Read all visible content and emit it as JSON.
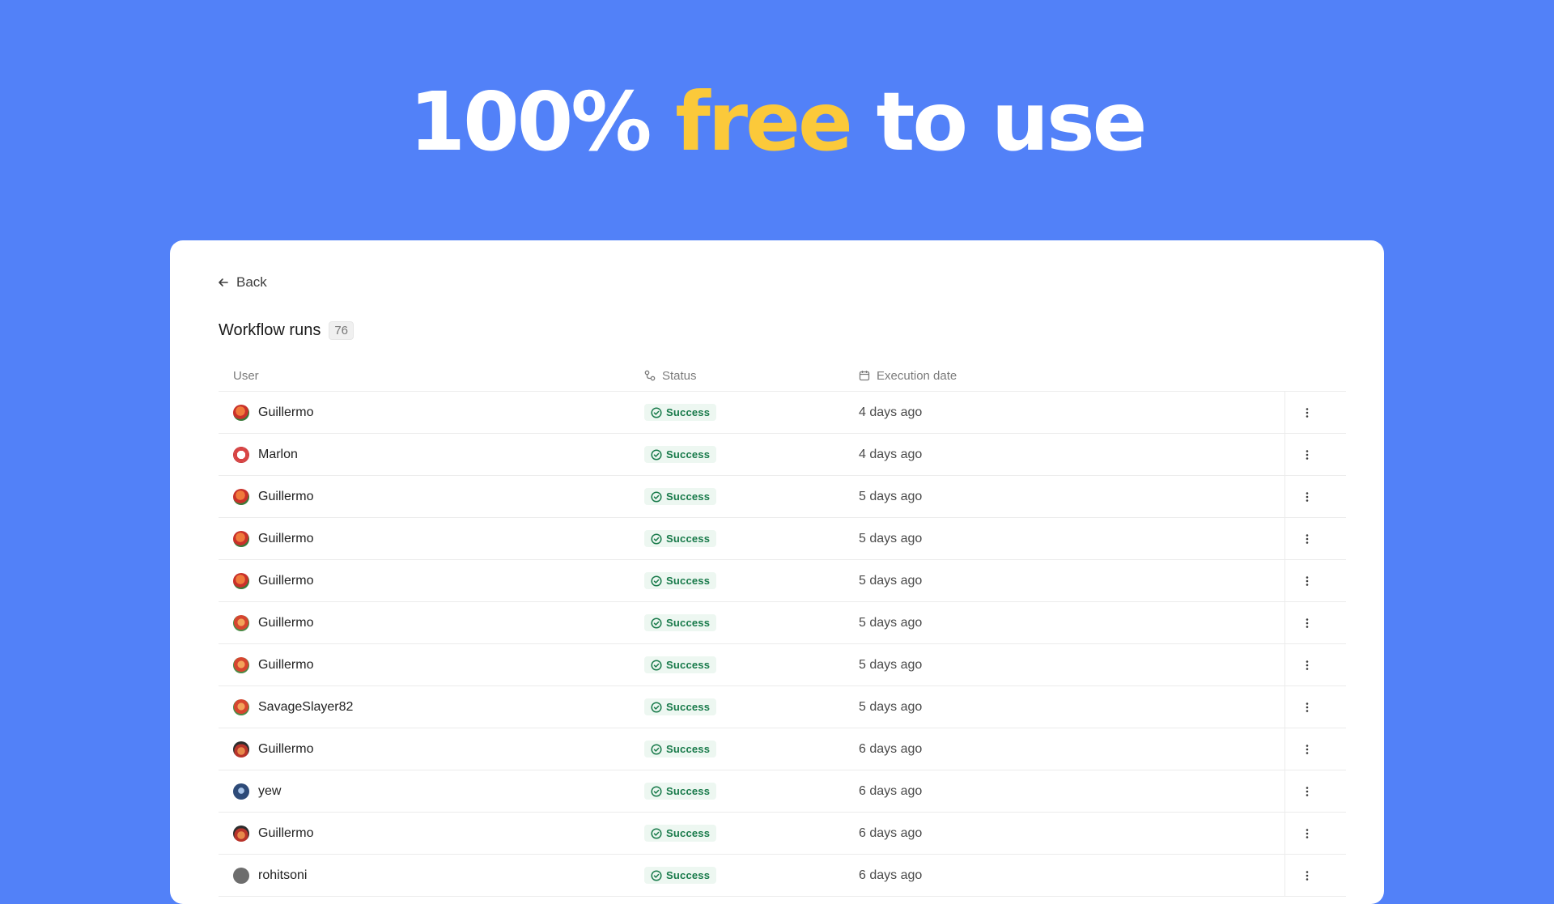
{
  "hero": {
    "part1": "100%",
    "accent": "free",
    "part2": "to use",
    "accent_color": "#fbc93a",
    "background_color": "#5281f8"
  },
  "panel": {
    "back_label": "Back",
    "title": "Workflow runs",
    "count": "76"
  },
  "table": {
    "columns": {
      "user": "User",
      "status": "Status",
      "execution_date": "Execution date"
    },
    "status_color": "#187a4a",
    "rows": [
      {
        "user": "Guillermo",
        "avatar": "red",
        "status": "Success",
        "date": "4 days ago"
      },
      {
        "user": "Marlon",
        "avatar": "clown",
        "status": "Success",
        "date": "4 days ago"
      },
      {
        "user": "Guillermo",
        "avatar": "red",
        "status": "Success",
        "date": "5 days ago"
      },
      {
        "user": "Guillermo",
        "avatar": "red",
        "status": "Success",
        "date": "5 days ago"
      },
      {
        "user": "Guillermo",
        "avatar": "red",
        "status": "Success",
        "date": "5 days ago"
      },
      {
        "user": "Guillermo",
        "avatar": "mix",
        "status": "Success",
        "date": "5 days ago"
      },
      {
        "user": "Guillermo",
        "avatar": "mix",
        "status": "Success",
        "date": "5 days ago"
      },
      {
        "user": "SavageSlayer82",
        "avatar": "mix",
        "status": "Success",
        "date": "5 days ago"
      },
      {
        "user": "Guillermo",
        "avatar": "hat",
        "status": "Success",
        "date": "6 days ago"
      },
      {
        "user": "yew",
        "avatar": "dark",
        "status": "Success",
        "date": "6 days ago"
      },
      {
        "user": "Guillermo",
        "avatar": "hat",
        "status": "Success",
        "date": "6 days ago"
      },
      {
        "user": "rohitsoni",
        "avatar": "grey",
        "status": "Success",
        "date": "6 days ago"
      }
    ]
  }
}
